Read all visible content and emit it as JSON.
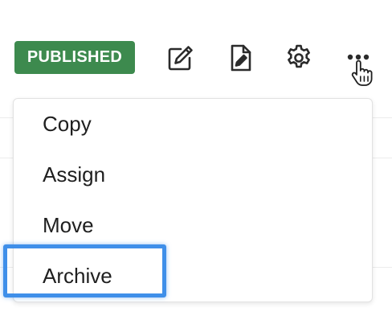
{
  "status_badge": {
    "label": "PUBLISHED",
    "color": "#3d8a4e"
  },
  "toolbar": {
    "edit_icon": "edit-icon",
    "document_icon": "document-edit-icon",
    "settings_icon": "gear-icon",
    "more_icon": "more-options-icon"
  },
  "menu": {
    "items": [
      {
        "label": "Copy"
      },
      {
        "label": "Assign"
      },
      {
        "label": "Move"
      },
      {
        "label": "Archive"
      }
    ],
    "highlighted_item": "Archive",
    "highlight_color": "#3f8fe9"
  }
}
